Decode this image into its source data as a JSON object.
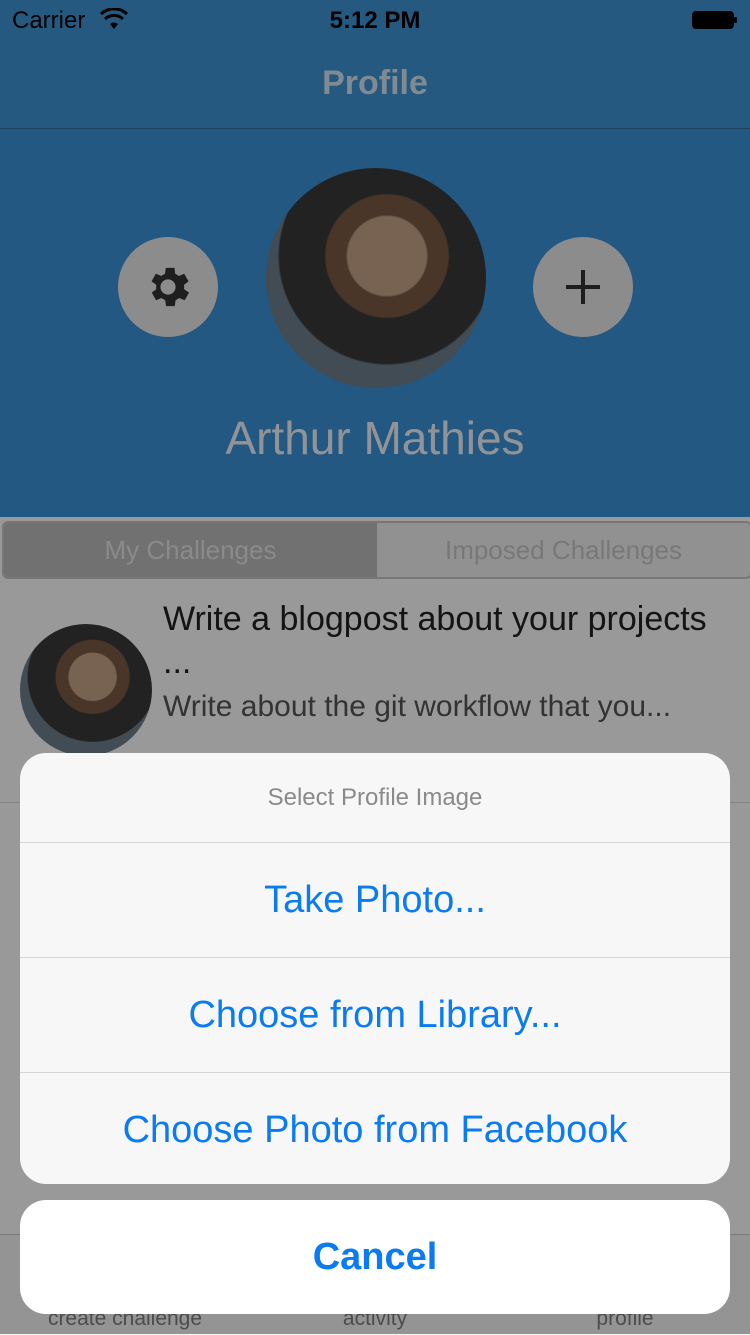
{
  "status_bar": {
    "carrier": "Carrier",
    "time": "5:12 PM"
  },
  "nav": {
    "title": "Profile"
  },
  "profile": {
    "name": "Arthur Mathies"
  },
  "segments": [
    "My Challenges",
    "Imposed Challenges"
  ],
  "challenge": {
    "title": "Write a blogpost about your projects ...",
    "description": "Write about the git workflow that you..."
  },
  "tabs": [
    "create challenge",
    "activity",
    "profile"
  ],
  "action_sheet": {
    "title": "Select Profile Image",
    "options": [
      "Take Photo...",
      "Choose from Library...",
      "Choose Photo from Facebook"
    ],
    "cancel": "Cancel"
  },
  "colors": {
    "accent": "#0a7bf0",
    "header_blue": "#3a93d8"
  }
}
